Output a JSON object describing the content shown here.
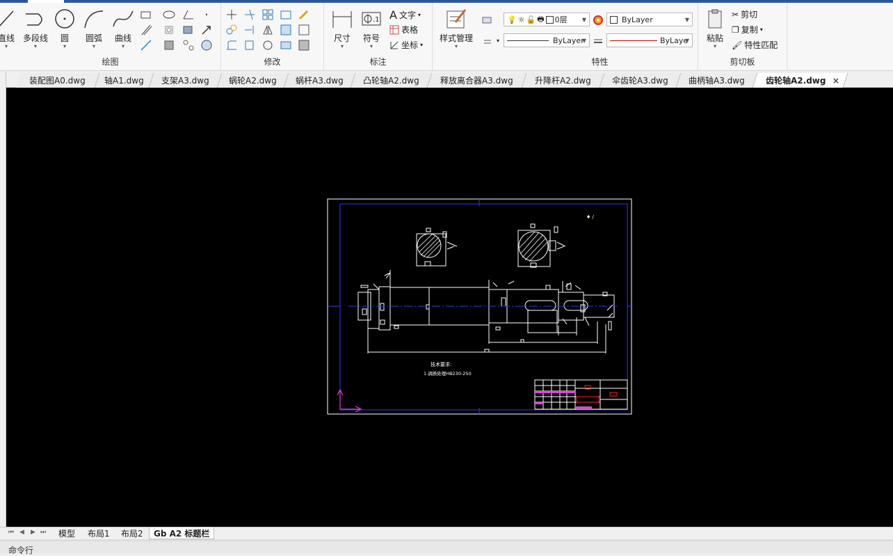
{
  "ribbon": {
    "draw": {
      "label": "绘图",
      "line": "直线",
      "polyline": "多段线",
      "circle": "圆",
      "arc": "圆弧",
      "curve": "曲线"
    },
    "modify": {
      "label": "修改"
    },
    "annotate": {
      "label": "标注",
      "dimension": "尺寸",
      "symbol": "符号",
      "text": "文字",
      "table": "表格",
      "coordinate": "坐标"
    },
    "style": {
      "label": "样式管理"
    },
    "properties": {
      "label": "特性",
      "layer": "0层",
      "color": "ByLayer",
      "linetype": "ByLayer",
      "lineweight": "ByLaye"
    },
    "clipboard": {
      "label": "剪切板",
      "paste": "粘贴",
      "cut": "剪切",
      "copy": "复制",
      "match": "特性匹配"
    }
  },
  "doc_tabs": [
    "装配图A0.dwg",
    "轴A1.dwg",
    "支架A3.dwg",
    "蜗轮A2.dwg",
    "蜗杆A3.dwg",
    "凸轮轴A2.dwg",
    "释放离合器A3.dwg",
    "升降杆A2.dwg",
    "伞齿轮A3.dwg",
    "曲柄轴A3.dwg",
    "齿轮轴A2.dwg"
  ],
  "active_doc": "齿轮轴A2.dwg",
  "close_glyph": "×",
  "layout_tabs": [
    "模型",
    "布局1",
    "布局2",
    "Gb A2 标题栏"
  ],
  "command_label": "命令行",
  "drawing": {
    "note1": "技术要求:",
    "note2": "1.调质处理HB230-250"
  },
  "colors": {
    "accent": "#2b579a",
    "canvas": "#000000",
    "frame_blue": "#3333ff",
    "ucs_magenta": "#e040e0",
    "highlight_red": "#ff2020"
  }
}
